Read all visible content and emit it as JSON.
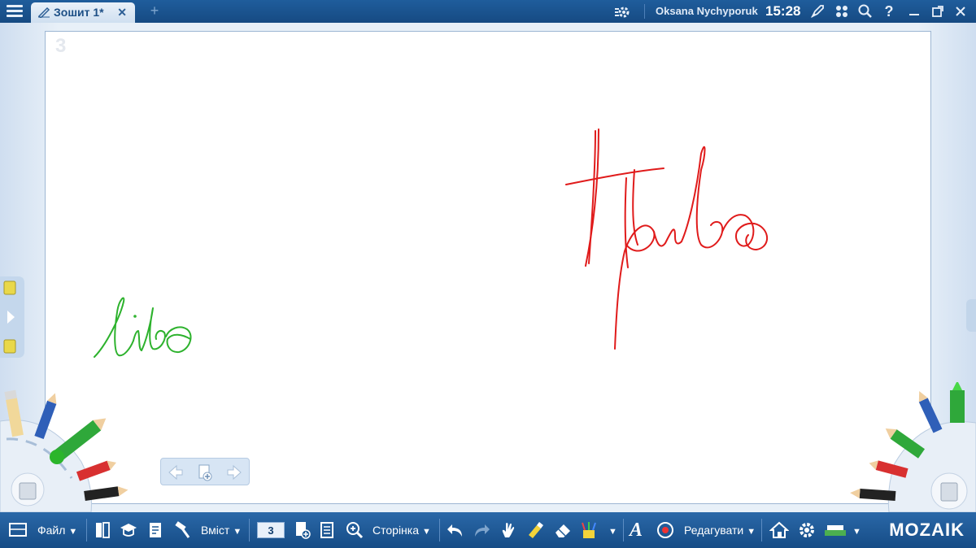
{
  "titlebar": {
    "tab_title": "Зошит 1*",
    "close_glyph": "✕",
    "add_glyph": "+",
    "user_name": "Oksana Nychyporuk",
    "time": "15:28"
  },
  "canvas": {
    "page_number": "3",
    "ink": [
      {
        "text": "libo",
        "color": "#2db22d"
      },
      {
        "text": "Право",
        "color": "#e01b1b"
      }
    ]
  },
  "toolbar": {
    "file_label": "Файл",
    "content_label": "Вміст",
    "page_value": "3",
    "page_label": "Сторінка",
    "edit_label": "Редагувати",
    "logo": "MOZAIK"
  },
  "colors": {
    "titlebar": "#1f5d9c",
    "toolbar": "#1c5894",
    "ink_green": "#2db22d",
    "ink_red": "#e01b1b"
  }
}
